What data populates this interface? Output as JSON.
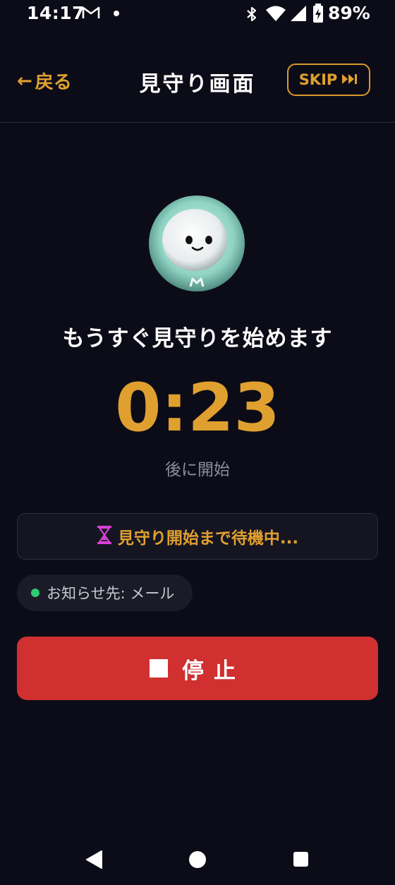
{
  "status_bar": {
    "time": "14:17",
    "battery": "89%",
    "icons": [
      "gmail-icon",
      "notification-dot",
      "bluetooth-icon",
      "wifi-icon",
      "signal-icon",
      "battery-icon"
    ]
  },
  "header": {
    "back_label": "戻る",
    "back_arrow": "←",
    "title": "見守り画面",
    "skip_label": "SKIP",
    "skip_icon": "fast-forward-icon"
  },
  "avatar": {
    "icon": "robot-mascot-avatar",
    "badge": "M"
  },
  "countdown": {
    "message": "もうすぐ見守りを始めます",
    "time_remaining": "0:23",
    "sub_label": "後に開始"
  },
  "status_card": {
    "icon": "hourglass-icon",
    "text": "見守り開始まで待機中..."
  },
  "notify": {
    "text": "お知らせ先: メール",
    "dot_color": "#2ecc71"
  },
  "stop_button": {
    "label": "停止",
    "icon": "stop-square-icon"
  },
  "colors": {
    "background": "#0c0c18",
    "accent": "#e0a030",
    "danger": "#d03030",
    "muted": "#8e8e9a"
  },
  "nav_bar": {
    "icons": [
      "nav-back-icon",
      "nav-home-icon",
      "nav-recents-icon"
    ]
  }
}
